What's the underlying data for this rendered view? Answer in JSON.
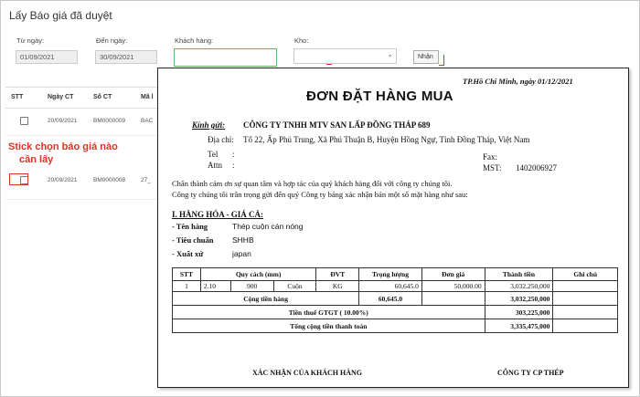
{
  "window": {
    "title": "Lấy Báo giá đã duyệt"
  },
  "filters": {
    "from_label": "Từ ngày:",
    "from_value": "01/09/2021",
    "to_label": "Đến ngày:",
    "to_value": "30/09/2021",
    "customer_label": "Khách hàng:",
    "customer_value": "",
    "warehouse_label": "Kho:",
    "warehouse_value": "",
    "receive_button": "Nhận"
  },
  "grid": {
    "headers": [
      "STT",
      "Ngày CT",
      "Số CT",
      "Mã l"
    ],
    "rows": [
      {
        "date": "20/09/2021",
        "doc_no": "BM0000009",
        "code": "BAC"
      },
      {
        "date": "20/09/2021",
        "doc_no": "BM0000008",
        "code": "27_"
      }
    ]
  },
  "annotation": {
    "line1": "Stick chọn báo giá  nào",
    "line2": "cần lấy"
  },
  "doc": {
    "place_date": "TP.Hồ Chí Minh, ngày  01/12/2021",
    "title": "ĐƠN ĐẶT HÀNG MUA",
    "to_label": "Kính gửi:",
    "company": "CÔNG TY TNHH MTV SAN LẤP ĐỒNG THÁP 689",
    "address_label": "Địa chỉ:",
    "address": "Tổ 22, Ấp Phú Trung, Xã Phú Thuận B, Huyện Hồng Ngự, Tỉnh Đồng Tháp, Việt Nam",
    "tel_label": "Tel",
    "attn_label": "Attn",
    "colon": ":",
    "fax_label": "Fax:",
    "mst_label": "MST:",
    "mst_value": "1402006927",
    "intro1": "Chân thành cảm ơn sự quan tâm và  hợp tác của quý khách hàng đối với công ty chúng tôi.",
    "intro2": "Công ty chúng tôi trân trọng gửi đến quý Công ty bảng xác nhận bán một số mặt hàng như sau:",
    "section": "I. HÀNG HÓA - GIÁ CẢ:",
    "goods_name_label": "- Tên hàng",
    "goods_name": "Thép cuộn cán nóng",
    "standard_label": "- Tiêu chuẩn",
    "standard": "SHHB",
    "origin_label": "- Xuất xứ",
    "origin": "japan",
    "table_headers": {
      "stt": "STT",
      "spec": "Quy cách (mm)",
      "unit": "ĐVT",
      "weight": "Trọng lượng",
      "price": "Đơn giá",
      "amount": "Thành tiền",
      "note": "Ghi chú"
    },
    "row": {
      "stt": "1",
      "spec1": "2.10",
      "spec2": "900",
      "spec3": "Cuộn",
      "unit": "KG",
      "weight": "60,645.0",
      "price": "50,000.00",
      "amount": "3,032,250,000"
    },
    "total_goods_label": "Cộng tiền hàng",
    "total_weight": "60,645.0",
    "total_goods": "3,032,250,000",
    "vat_label": "Tiền thuế GTGT ( 10.00%)",
    "vat": "303,225,000",
    "grand_label": "Tổng cộng tiền thanh toán",
    "grand": "3,335,475,000",
    "sign_customer": "XÁC NHẬN CỦA KHÁCH HÀNG",
    "sign_company": "CÔNG TY CP THÉP"
  },
  "icons": {
    "dropdown": "chevron-down-icon",
    "checkbox": "checkbox-icon"
  }
}
